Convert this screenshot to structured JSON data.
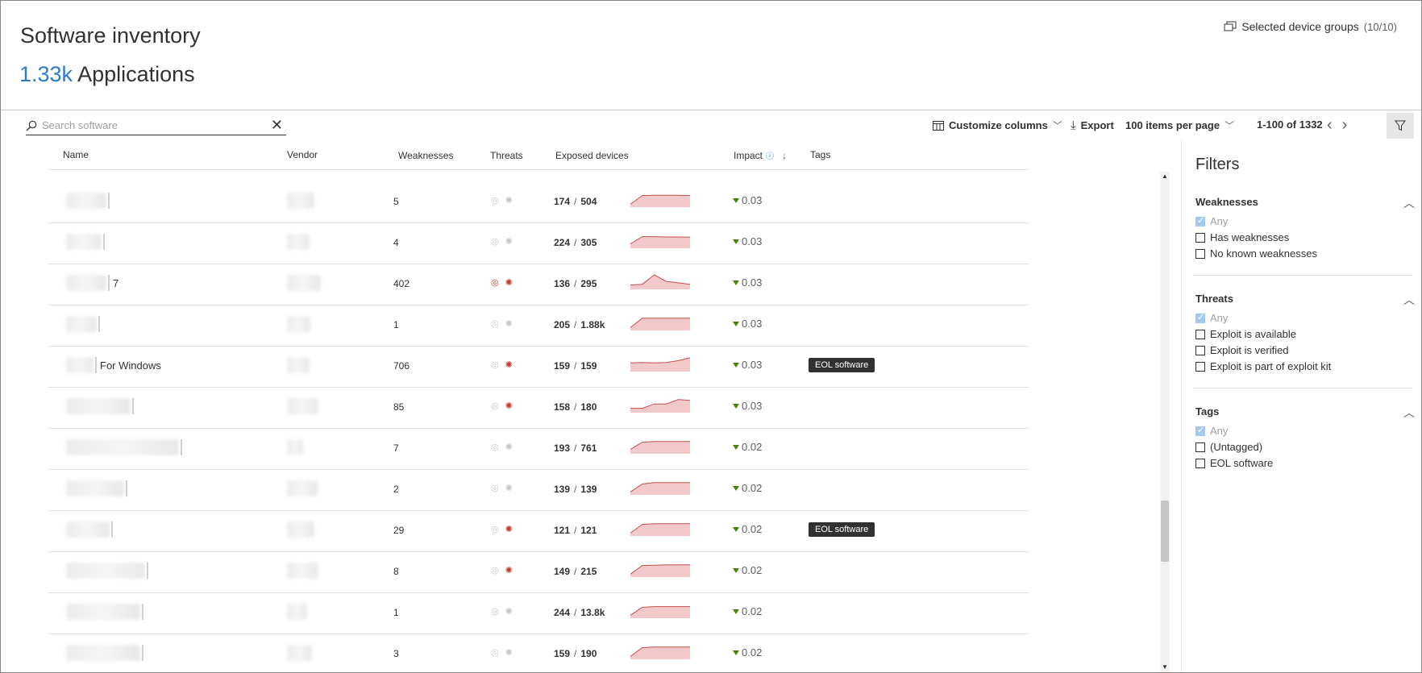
{
  "header": {
    "title": "Software inventory",
    "count": "1.33k",
    "count_label": "Applications",
    "device_groups_label": "Selected device groups",
    "device_groups_count": "(10/10)"
  },
  "toolbar": {
    "search_placeholder": "Search software",
    "customize_label": "Customize columns",
    "export_label": "Export",
    "per_page_label": "100 items per page",
    "pagination": "1-100 of 1332"
  },
  "columns": {
    "name": "Name",
    "vendor": "Vendor",
    "weaknesses": "Weaknesses",
    "threats": "Threats",
    "exposed": "Exposed devices",
    "impact": "Impact",
    "tags": "Tags"
  },
  "rows": [
    {
      "name_suffix": "",
      "weaknesses": "5",
      "threat_active": false,
      "bug_active": false,
      "exposed": "174",
      "total": "504",
      "impact": "0.03",
      "tag": "",
      "trend": [
        0.2,
        0.8,
        0.82,
        0.82,
        0.82,
        0.8
      ]
    },
    {
      "name_suffix": "",
      "weaknesses": "4",
      "threat_active": false,
      "bug_active": false,
      "exposed": "224",
      "total": "305",
      "impact": "0.03",
      "tag": "",
      "trend": [
        0.3,
        0.8,
        0.8,
        0.78,
        0.78,
        0.76
      ]
    },
    {
      "name_suffix": "7",
      "weaknesses": "402",
      "threat_active": true,
      "bug_active": true,
      "exposed": "136",
      "total": "295",
      "impact": "0.03",
      "tag": "",
      "trend": [
        0.3,
        0.35,
        1.0,
        0.55,
        0.45,
        0.35
      ]
    },
    {
      "name_suffix": "",
      "weaknesses": "1",
      "threat_active": false,
      "bug_active": false,
      "exposed": "205",
      "total": "1.88k",
      "impact": "0.03",
      "tag": "",
      "trend": [
        0.2,
        0.85,
        0.85,
        0.85,
        0.85,
        0.85
      ]
    },
    {
      "name_suffix": "For Windows",
      "weaknesses": "706",
      "threat_active": false,
      "bug_active": true,
      "exposed": "159",
      "total": "159",
      "impact": "0.03",
      "tag": "EOL software",
      "trend": [
        0.6,
        0.62,
        0.6,
        0.62,
        0.75,
        0.95
      ]
    },
    {
      "name_suffix": "",
      "weaknesses": "85",
      "threat_active": false,
      "bug_active": true,
      "exposed": "158",
      "total": "180",
      "impact": "0.03",
      "tag": "",
      "trend": [
        0.3,
        0.3,
        0.6,
        0.6,
        0.9,
        0.85
      ]
    },
    {
      "name_suffix": "",
      "weaknesses": "7",
      "threat_active": false,
      "bug_active": false,
      "exposed": "193",
      "total": "761",
      "impact": "0.02",
      "tag": "",
      "trend": [
        0.3,
        0.8,
        0.85,
        0.85,
        0.85,
        0.85
      ]
    },
    {
      "name_suffix": "",
      "weaknesses": "2",
      "threat_active": false,
      "bug_active": false,
      "exposed": "139",
      "total": "139",
      "impact": "0.02",
      "tag": "",
      "trend": [
        0.2,
        0.75,
        0.85,
        0.85,
        0.85,
        0.85
      ]
    },
    {
      "name_suffix": "",
      "weaknesses": "29",
      "threat_active": false,
      "bug_active": true,
      "exposed": "121",
      "total": "121",
      "impact": "0.02",
      "tag": "EOL software",
      "trend": [
        0.2,
        0.8,
        0.85,
        0.85,
        0.85,
        0.85
      ]
    },
    {
      "name_suffix": "",
      "weaknesses": "8",
      "threat_active": false,
      "bug_active": true,
      "exposed": "149",
      "total": "215",
      "impact": "0.02",
      "tag": "",
      "trend": [
        0.2,
        0.8,
        0.82,
        0.84,
        0.85,
        0.85
      ]
    },
    {
      "name_suffix": "",
      "weaknesses": "1",
      "threat_active": false,
      "bug_active": false,
      "exposed": "244",
      "total": "13.8k",
      "impact": "0.02",
      "tag": "",
      "trend": [
        0.2,
        0.75,
        0.8,
        0.8,
        0.8,
        0.8
      ]
    },
    {
      "name_suffix": "",
      "weaknesses": "3",
      "threat_active": false,
      "bug_active": false,
      "exposed": "159",
      "total": "190",
      "impact": "0.02",
      "tag": "",
      "trend": [
        0.2,
        0.8,
        0.85,
        0.85,
        0.85,
        0.85
      ]
    }
  ],
  "filters": {
    "title": "Filters",
    "sections": [
      {
        "title": "Weaknesses",
        "options": [
          {
            "label": "Any",
            "checked": true
          },
          {
            "label": "Has weaknesses",
            "checked": false
          },
          {
            "label": "No known weaknesses",
            "checked": false
          }
        ]
      },
      {
        "title": "Threats",
        "options": [
          {
            "label": "Any",
            "checked": true
          },
          {
            "label": "Exploit is available",
            "checked": false
          },
          {
            "label": "Exploit is verified",
            "checked": false
          },
          {
            "label": "Exploit is part of exploit kit",
            "checked": false
          }
        ]
      },
      {
        "title": "Tags",
        "options": [
          {
            "label": "Any",
            "checked": true
          },
          {
            "label": "(Untagged)",
            "checked": false
          },
          {
            "label": "EOL software",
            "checked": false
          }
        ]
      }
    ]
  },
  "colors": {
    "accent": "#2b7bd0",
    "spark_fill": "#f2c9cb",
    "spark_line": "#c0504d",
    "impact_down": "#498205",
    "threat_active": "#c0392b",
    "threat_inactive": "#c8c6c4"
  }
}
